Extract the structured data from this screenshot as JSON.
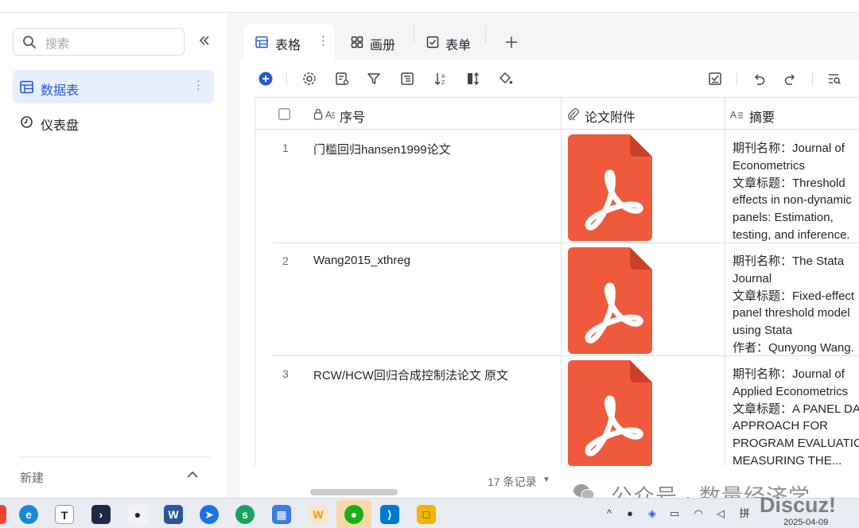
{
  "sidebar": {
    "search_placeholder": "搜索",
    "items": [
      {
        "label": "数据表",
        "active": true,
        "icon": "table-icon"
      },
      {
        "label": "仪表盘",
        "active": false,
        "icon": "dashboard-icon"
      }
    ],
    "new_label": "新建"
  },
  "tabs": [
    {
      "label": "表格",
      "icon": "grid-icon",
      "active": true
    },
    {
      "label": "画册",
      "icon": "gallery-icon",
      "active": false
    },
    {
      "label": "表单",
      "icon": "form-icon",
      "active": false
    }
  ],
  "table": {
    "columns": [
      {
        "label": "序号",
        "icon": "lock-text-icon"
      },
      {
        "label": "论文附件",
        "icon": "paperclip-icon"
      },
      {
        "label": "摘要",
        "icon": "text-icon"
      }
    ],
    "rows": [
      {
        "num": "1",
        "title": "门槛回归hansen1999论文",
        "abstract": "期刊名称：Journal of\nEconometrics\n文章标题：Threshold\neffects in non-dynamic\npanels: Estimation,\ntesting, and inference."
      },
      {
        "num": "2",
        "title": "Wang2015_xthreg",
        "abstract": "期刊名称：The Stata\nJournal\n文章标题：Fixed-effect\npanel threshold model\nusing Stata\n作者：Qunyong Wang."
      },
      {
        "num": "3",
        "title": "RCW/HCW回归合成控制法论文 原文",
        "abstract": "期刊名称：Journal of\nApplied Econometrics\n文章标题：A PANEL DA\nAPPROACH FOR\nPROGRAM EVALUATIO\nMEASURING THE..."
      }
    ],
    "record_count": "17 条记录"
  },
  "watermark": {
    "text": "公众号 · 数量经济学",
    "discuz": "Discuz!"
  },
  "taskbar": {
    "date": "2025-04-09"
  },
  "colors": {
    "accent": "#245bdb",
    "pdf_red": "#f05a3c",
    "active_bg": "#e8eefc"
  }
}
